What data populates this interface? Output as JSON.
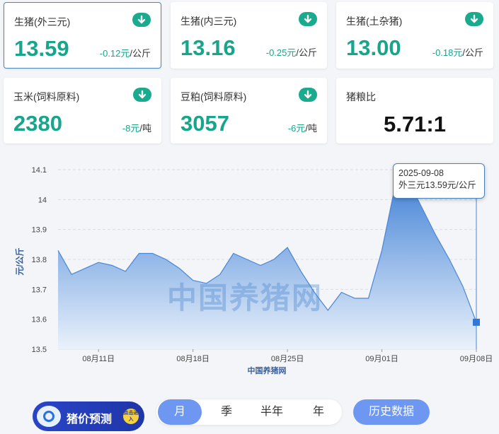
{
  "cards": [
    {
      "label": "生猪(外三元)",
      "value": "13.59",
      "delta": "-0.12元",
      "unit": "/公斤",
      "icon": "arrow-down-icon"
    },
    {
      "label": "生猪(内三元)",
      "value": "13.16",
      "delta": "-0.25元",
      "unit": "/公斤",
      "icon": "arrow-down-icon"
    },
    {
      "label": "生猪(土杂猪)",
      "value": "13.00",
      "delta": "-0.18元",
      "unit": "/公斤",
      "icon": "arrow-down-icon"
    },
    {
      "label": "玉米(饲料原料)",
      "value": "2380",
      "delta": "-8元",
      "unit": "/吨",
      "icon": "arrow-down-icon"
    },
    {
      "label": "豆粕(饲料原料)",
      "value": "3057",
      "delta": "-6元",
      "unit": "/吨",
      "icon": "arrow-down-icon"
    },
    {
      "label": "猪粮比",
      "value": "5.71:1"
    }
  ],
  "colors": {
    "accent_green": "#17a58c",
    "chart_line": "#4a86d4",
    "button_blue": "#6d97f0"
  },
  "chart_data": {
    "type": "area",
    "ylabel": "元/公斤",
    "xlabel": "中国养猪网",
    "ylim": [
      13.5,
      14.1
    ],
    "yticks": [
      "14.1",
      "14",
      "13.9",
      "13.8",
      "13.7",
      "13.6",
      "13.5"
    ],
    "xticks": [
      "08月11日",
      "08月18日",
      "08月25日",
      "09月01日",
      "09月08日"
    ],
    "x": [
      "2025-08-08",
      "2025-08-09",
      "2025-08-10",
      "2025-08-11",
      "2025-08-12",
      "2025-08-13",
      "2025-08-14",
      "2025-08-15",
      "2025-08-16",
      "2025-08-17",
      "2025-08-18",
      "2025-08-19",
      "2025-08-20",
      "2025-08-21",
      "2025-08-22",
      "2025-08-23",
      "2025-08-24",
      "2025-08-25",
      "2025-08-26",
      "2025-08-27",
      "2025-08-28",
      "2025-08-29",
      "2025-08-30",
      "2025-08-31",
      "2025-09-01",
      "2025-09-02",
      "2025-09-03",
      "2025-09-04",
      "2025-09-05",
      "2025-09-06",
      "2025-09-07",
      "2025-09-08"
    ],
    "values": [
      13.83,
      13.75,
      13.77,
      13.79,
      13.78,
      13.76,
      13.82,
      13.82,
      13.8,
      13.77,
      13.73,
      13.72,
      13.75,
      13.82,
      13.8,
      13.78,
      13.8,
      13.84,
      13.76,
      13.69,
      13.63,
      13.69,
      13.67,
      13.67,
      13.83,
      14.05,
      14.06,
      13.97,
      13.88,
      13.8,
      13.71,
      13.59
    ],
    "grid": true
  },
  "tooltip": {
    "date": "2025-09-08",
    "text": "外三元13.59元/公斤"
  },
  "watermark": "中国养猪网",
  "promo": {
    "text": "猪价预测",
    "badge": "点击进入"
  },
  "periods": [
    "月",
    "季",
    "半年",
    "年"
  ],
  "history_button": "历史数据"
}
